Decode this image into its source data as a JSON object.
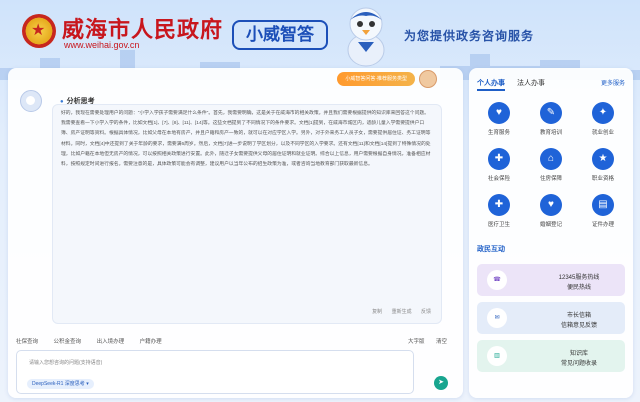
{
  "header": {
    "gov_title": "威海市人民政府",
    "gov_url": "www.weihai.gov.cn",
    "logo": "小威智答",
    "slogan": "为您提供政务咨询服务"
  },
  "chat": {
    "recommend_label": "小威智答问答·推荐服务类型",
    "analysis_label": "分析思考",
    "answer_text": "好的，我现在需要处理用户的问题：\"小学入学孩子需要满足什么条件\"。首先，我需要明确，这是关于在威海市的相关政策。并且我们需要根据提供的知识库来回答这个问题。我需要查看一下小学入学的条件，比如文档[1]、[7]、[8]、[11]、[14]等。这些文档提到了不同情况下的条件要求。文档[1]提到，在威海市城区内，适龄儿童入学需要提供户口簿、房产证明等资料。根据具体情况，比如父母在本地有房产，并且户籍和房产一致的，就可以在对应学区入学。另外，对于外来务工人员子女，需要提供居住证、务工证明等材料。同时，文档[4]中还提到了关于年龄的要求，需要满6周岁。然后，文档[7]进一步说明了学区划分，以及不同学区的入学要求。还有文档[11]和文档[14]提到了特殊情况的处理，比如户籍在本地但无房产的情况，可以按照相关政策进行安置。此外，随迁子女需要提供父母的居住证明和就业证明。综合以上信息，用户需要根据自身情况，准备相应材料，按照规定时间进行报名。需要注意的是，具体政策可能会有调整，建议用户以当年公布的招生政策为准，或者咨询当地教育部门获取最新信息。",
    "actions": [
      "复制",
      "重新生成",
      "反馈"
    ],
    "toolbar": [
      "社保查询",
      "公积金查询",
      "出入境办理",
      "户籍办理"
    ],
    "toolbar_right": [
      "大字版",
      "清空"
    ],
    "input_placeholder": "请输入您想咨询的问题(支持语音)",
    "model_label": "DeepSeek-R1 深度思考"
  },
  "panel": {
    "tabs": [
      "个人办事",
      "法人办事"
    ],
    "more": "更多服务",
    "items": [
      {
        "label": "生育服务",
        "icon": "baby-icon",
        "glyph": "♥"
      },
      {
        "label": "教育培训",
        "icon": "book-icon",
        "glyph": "✎"
      },
      {
        "label": "就业创业",
        "icon": "briefcase-icon",
        "glyph": "✦"
      },
      {
        "label": "社会保险",
        "icon": "shield-icon",
        "glyph": "✚"
      },
      {
        "label": "住房保障",
        "icon": "house-icon",
        "glyph": "⌂"
      },
      {
        "label": "职业资格",
        "icon": "certificate-icon",
        "glyph": "★"
      },
      {
        "label": "医疗卫生",
        "icon": "medical-icon",
        "glyph": "✚"
      },
      {
        "label": "婚姻登记",
        "icon": "rings-icon",
        "glyph": "♥"
      },
      {
        "label": "证件办理",
        "icon": "id-card-icon",
        "glyph": "▤"
      }
    ],
    "section_title": "政民互动",
    "cards": [
      {
        "line1": "12345服务热线",
        "line2": "便民热线",
        "bg": "#ece4f8",
        "icon": "hotline-icon"
      },
      {
        "line1": "市长信箱",
        "line2": "信箱意见反馈",
        "bg": "#e4ecf9",
        "icon": "mail-icon"
      },
      {
        "line1": "知识库",
        "line2": "常见问题收录",
        "bg": "#e3f4ee",
        "icon": "knowledge-icon"
      }
    ]
  }
}
